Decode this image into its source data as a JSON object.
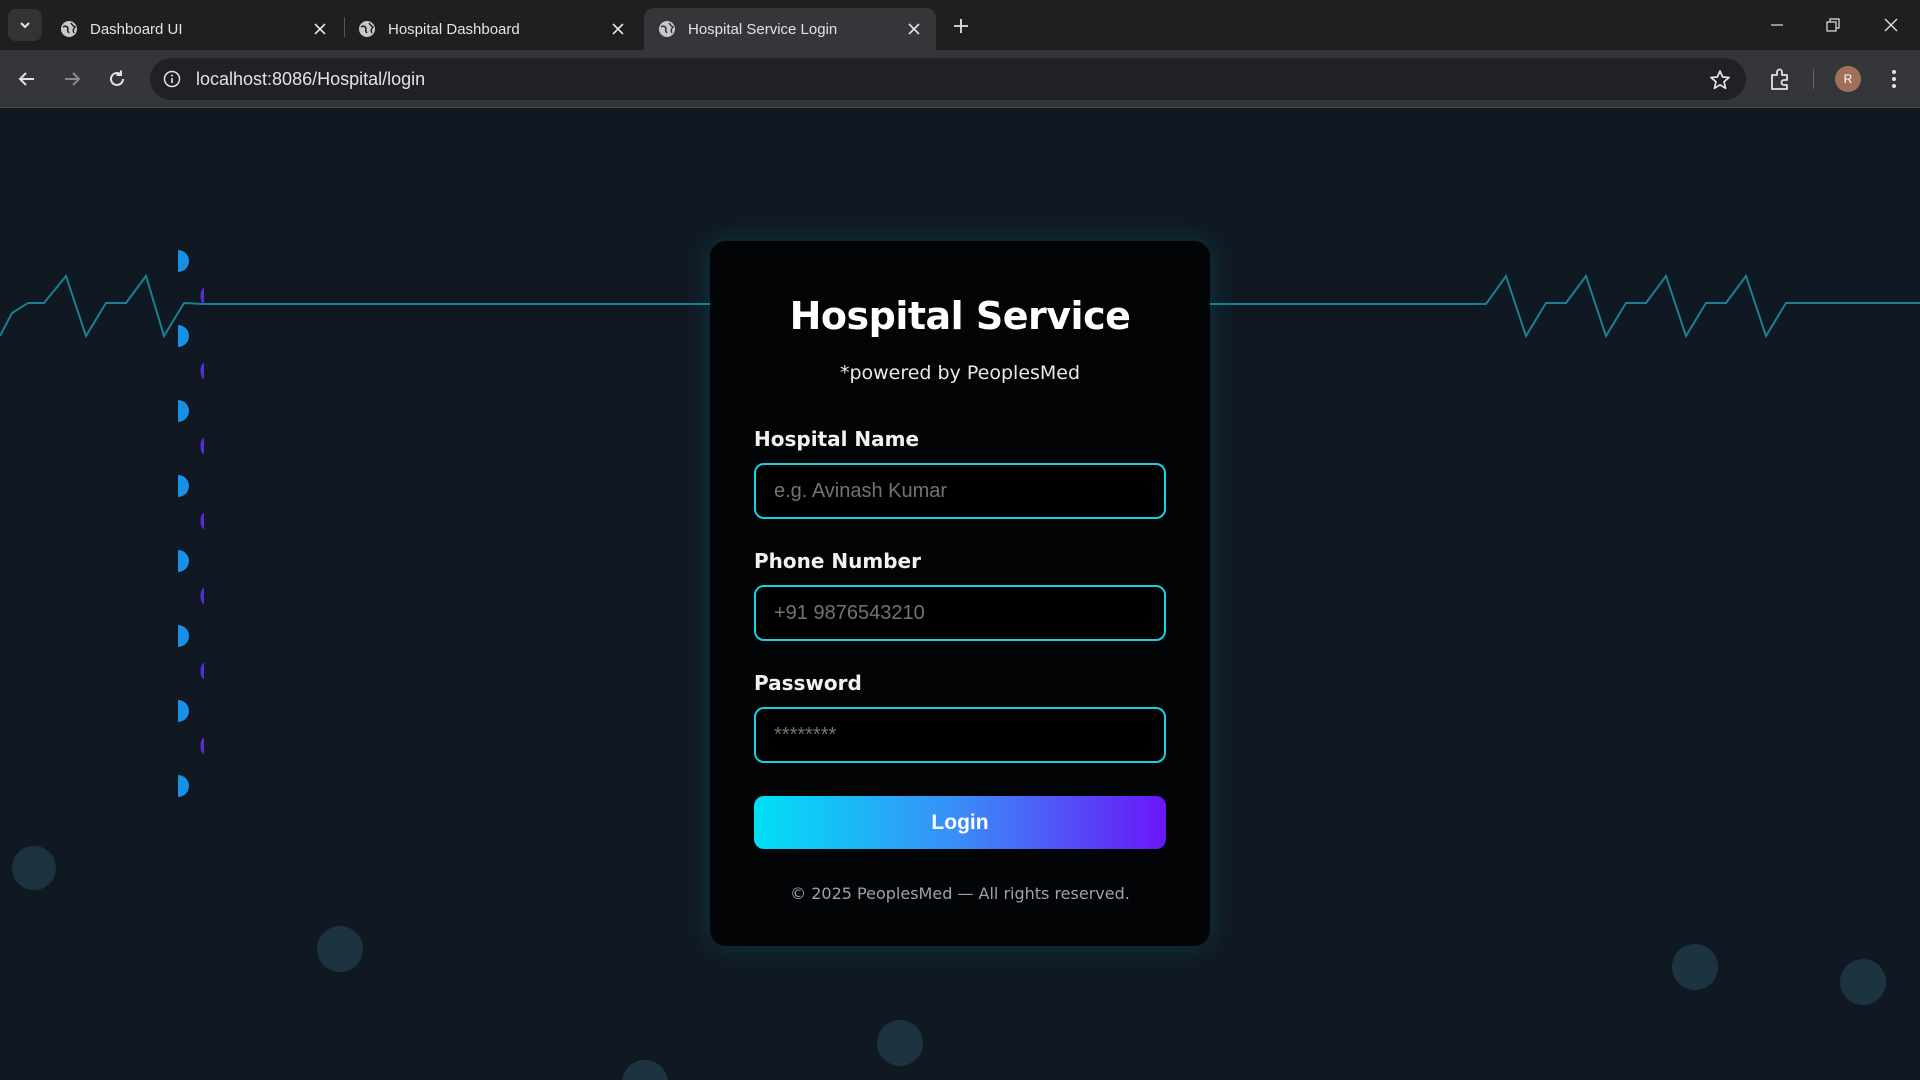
{
  "browser": {
    "tabs": [
      {
        "title": "Dashboard UI",
        "active": false
      },
      {
        "title": "Hospital Dashboard",
        "active": false
      },
      {
        "title": "Hospital Service Login",
        "active": true
      }
    ],
    "url": "localhost:8086/Hospital/login",
    "profile_initial": "R"
  },
  "login": {
    "title": "Hospital Service",
    "subtitle": "*powered by PeoplesMed",
    "hospital_name_label": "Hospital Name",
    "hospital_name_placeholder": "e.g. Avinash Kumar",
    "phone_label": "Phone Number",
    "phone_placeholder": "+91 9876543210",
    "password_label": "Password",
    "password_placeholder": "********",
    "button_label": "Login",
    "footer": "© 2025 PeoplesMed — All rights reserved."
  },
  "colors": {
    "accent": "#19d0e6",
    "gradient_start": "#00e0f5",
    "gradient_end": "#6a16f9",
    "background": "#101922",
    "card": "#020405"
  }
}
